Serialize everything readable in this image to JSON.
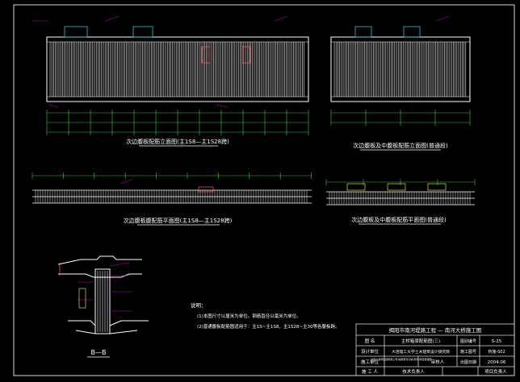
{
  "app": {
    "background": "#000000",
    "colors": {
      "frame": "#d8d8d8",
      "rebar": "#ffffff",
      "dimension": "#2fd02f",
      "label": "#ffff66",
      "callout": "#ff5555",
      "leader": "#c000c0",
      "cyan": "#30c8d8",
      "section": "#ff5555"
    }
  },
  "views": {
    "elevation_left_title": "次边腹板配筋立面图(主1S8—主1S28跨)",
    "elevation_right_title": "次边腹板及中腹板配筋立面图(普通段)",
    "plan_left_title": "次边腹板腹配筋平面图(主1S8—主1S28跨)",
    "plan_right_title": "次边腹板及中腹板配筋平面图(普通段)",
    "section_title": "B—B"
  },
  "notes": {
    "heading": "说明：",
    "line1": "(1)本图尺寸以厘米为单位。钢筋直径以毫米为单位。",
    "line2": "(2)普通腹板配筋图适用于：主1S~主1S8、主1S28~主30等各腹板跨。"
  },
  "title_block": {
    "project": "揭阳市南河堤路工程 — 南河大桥施工图",
    "drawing_name_label": "图 名",
    "drawing_name": "主桥箱梁配筋图(三)",
    "drawing_no_label": "图别编号",
    "drawing_no": "S-25",
    "design_unit_label": "设计单位",
    "design_unit": "大连理工大学土木建筑设计研究院",
    "project_no_label": "施工图号",
    "project_no": "桥施-S02",
    "construction_unit_label": "施工单位",
    "construction_unit": "中铁大桥局集团有限公司 揭阳南河大桥(南河)项目经理部",
    "review_label": "审核人",
    "date_label": "出图日期",
    "date": "2004.06",
    "site_person_label": "施 工 人",
    "tech_person_label": "技术负责人",
    "project_manager_label": "项目负责人"
  }
}
